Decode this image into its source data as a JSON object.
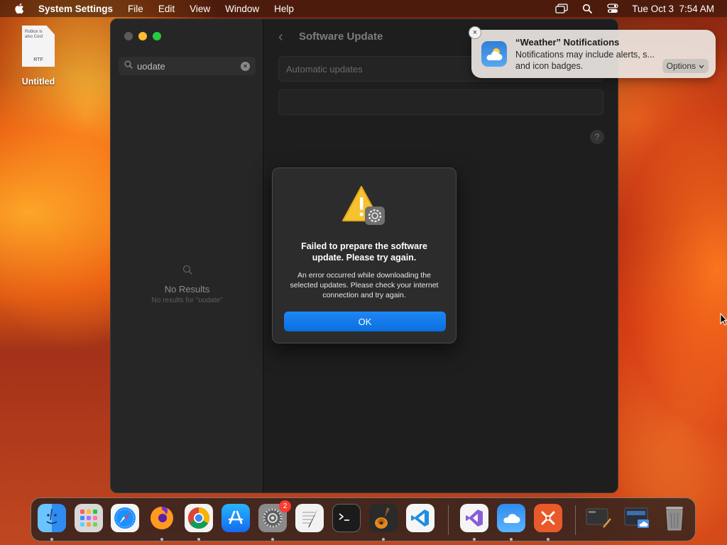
{
  "menubar": {
    "app_name": "System Settings",
    "items": [
      "File",
      "Edit",
      "View",
      "Window",
      "Help"
    ],
    "clock": "Tue Oct 3  7:54 AM"
  },
  "desktop": {
    "file_name": "Untitled",
    "file_preview_text": "Roblox is also Cool",
    "file_type": "RTF"
  },
  "settings": {
    "search_value": "uodate",
    "no_results_title": "No Results",
    "no_results_sub": "No results for \"uodate\"",
    "page_title": "Software Update",
    "automatic_updates_label": "Automatic updates",
    "help_label": "?"
  },
  "alert": {
    "title": "Failed to prepare the software update. Please try again.",
    "body": "An error occurred while downloading the selected updates. Please check your internet connection and try again.",
    "ok_label": "OK"
  },
  "notification": {
    "title": "“Weather” Notifications",
    "body": "Notifications may include alerts, s... and icon badges.",
    "options_label": "Options",
    "close_symbol": "×"
  },
  "dock": {
    "apps": [
      "Finder",
      "Launchpad",
      "Safari",
      "Firefox",
      "Chrome",
      "App Store",
      "System Settings",
      "TextEdit",
      "Terminal",
      "GarageBand",
      "Visual Studio Code",
      "Visual Studio",
      "iCloud",
      "Remote Desktop",
      "Screenshot",
      "Preview",
      "Trash"
    ],
    "system_settings_badge": "2"
  },
  "colors": {
    "accent": "#0a6fe0",
    "traffic_min": "#febc2e",
    "traffic_max": "#28c840",
    "badge": "#ff3b30"
  }
}
